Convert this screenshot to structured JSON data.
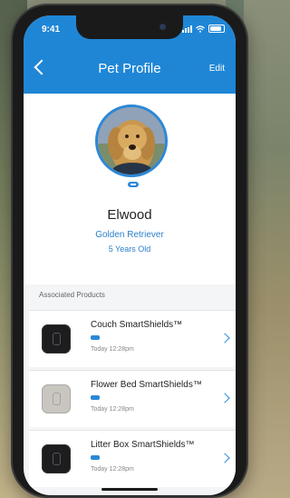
{
  "status_bar": {
    "time": "9:41"
  },
  "header": {
    "title": "Pet Profile",
    "edit_label": "Edit"
  },
  "pet": {
    "name": "Elwood",
    "breed": "Golden Retriever",
    "age": "5 Years Old"
  },
  "section": {
    "associated_label": "Associated Products"
  },
  "products": [
    {
      "name": "Couch SmartShields™",
      "time": "Today 12:28pm",
      "color": "black"
    },
    {
      "name": "Flower Bed SmartShields™",
      "time": "Today 12:28pm",
      "color": "silver"
    },
    {
      "name": "Litter Box SmartShields™",
      "time": "Today 12:28pm",
      "color": "black"
    }
  ],
  "colors": {
    "accent": "#1f86d6"
  }
}
